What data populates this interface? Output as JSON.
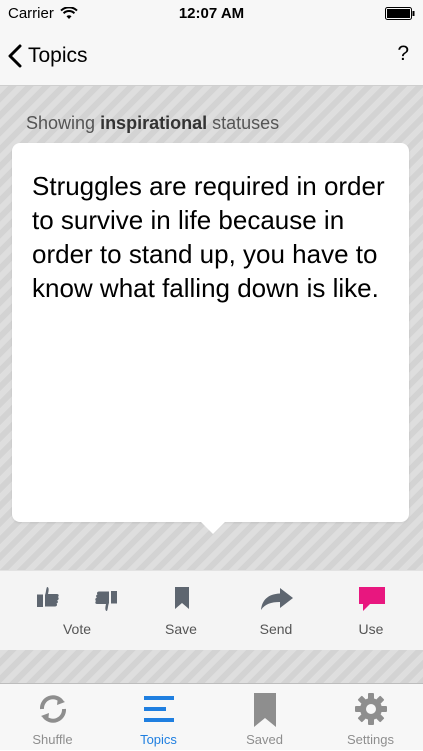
{
  "status_bar": {
    "carrier": "Carrier",
    "time": "12:07 AM"
  },
  "nav": {
    "back_label": "Topics",
    "help_label": "?"
  },
  "content": {
    "showing_prefix": "Showing",
    "showing_topic": "inspirational",
    "showing_suffix": "statuses",
    "quote": "Struggles are required in order to survive in life because in order to stand up, you have to know what falling down is like."
  },
  "actions": {
    "vote_label": "Vote",
    "save_label": "Save",
    "send_label": "Send",
    "use_label": "Use"
  },
  "tabs": [
    {
      "label": "Shuffle",
      "icon": "shuffle-icon"
    },
    {
      "label": "Topics",
      "icon": "topics-icon",
      "active": true
    },
    {
      "label": "Saved",
      "icon": "bookmark-icon"
    },
    {
      "label": "Settings",
      "icon": "gear-icon"
    }
  ],
  "colors": {
    "accent": "#1f7fe0",
    "use_pink": "#e8177f",
    "icon_gray": "#5e6670"
  }
}
